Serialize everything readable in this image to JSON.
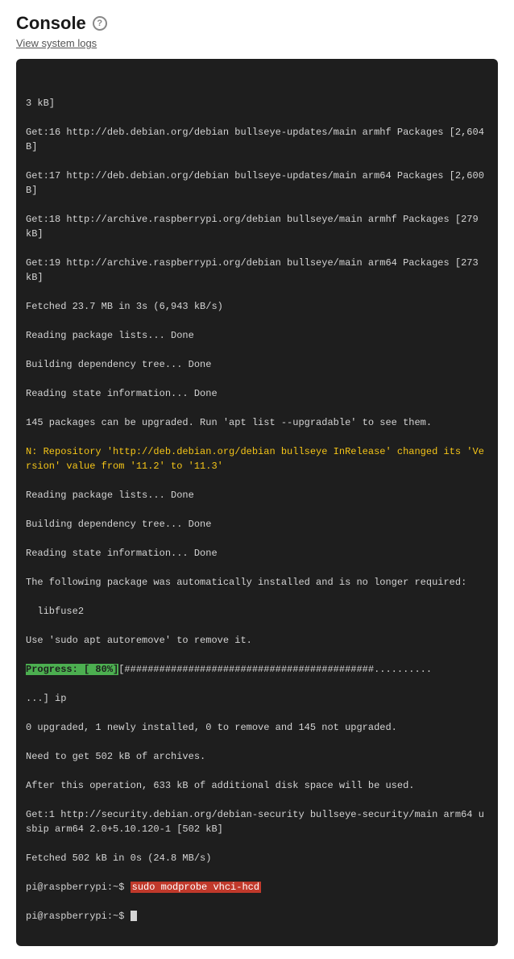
{
  "header": {
    "title": "Console",
    "help_tooltip": "Help",
    "subtitle": "View system logs"
  },
  "console": {
    "lines": [
      {
        "type": "normal",
        "text": "3 kB]"
      },
      {
        "type": "normal",
        "text": "Get:16 http://deb.debian.org/debian bullseye-updates/main armhf Packages [2,604 B]"
      },
      {
        "type": "normal",
        "text": "Get:17 http://deb.debian.org/debian bullseye-updates/main arm64 Packages [2,600 B]"
      },
      {
        "type": "normal",
        "text": "Get:18 http://archive.raspberrypi.org/debian bullseye/main armhf Packages [279 kB]"
      },
      {
        "type": "normal",
        "text": "Get:19 http://archive.raspberrypi.org/debian bullseye/main arm64 Packages [273 kB]"
      },
      {
        "type": "normal",
        "text": "Fetched 23.7 MB in 3s (6,943 kB/s)"
      },
      {
        "type": "normal",
        "text": "Reading package lists... Done"
      },
      {
        "type": "normal",
        "text": "Building dependency tree... Done"
      },
      {
        "type": "normal",
        "text": "Reading state information... Done"
      },
      {
        "type": "normal",
        "text": "145 packages can be upgraded. Run 'apt list --upgradable' to see them."
      },
      {
        "type": "yellow",
        "text": "N: Repository 'http://deb.debian.org/debian bullseye InRelease' changed its 'Version' value from '11.2' to '11.3'"
      },
      {
        "type": "normal",
        "text": "Reading package lists... Done"
      },
      {
        "type": "normal",
        "text": "Building dependency tree... Done"
      },
      {
        "type": "normal",
        "text": "Reading state information... Done"
      },
      {
        "type": "normal",
        "text": "The following package was automatically installed and is no longer required:"
      },
      {
        "type": "normal",
        "text": "  libfuse2"
      },
      {
        "type": "normal",
        "text": "Use 'sudo apt autoremove' to remove it."
      },
      {
        "type": "progress",
        "label": "Progress: [ 80%]",
        "bar": "[###########################################.........."
      },
      {
        "type": "normal",
        "text": "...] ip"
      },
      {
        "type": "normal",
        "text": "0 upgraded, 1 newly installed, 0 to remove and 145 not upgraded."
      },
      {
        "type": "normal",
        "text": "Need to get 502 kB of archives."
      },
      {
        "type": "normal",
        "text": "After this operation, 633 kB of additional disk space will be used."
      },
      {
        "type": "normal",
        "text": "Get:1 http://security.debian.org/debian-security bullseye-security/main arm64 usbip arm64 2.0+5.10.120-1 [502 kB]"
      },
      {
        "type": "normal",
        "text": "Fetched 502 kB in 0s (24.8 MB/s)"
      },
      {
        "type": "cmd",
        "prompt": "pi@raspberrypi:~$ ",
        "cmd": "sudo modprobe vhci-hcd"
      },
      {
        "type": "prompt_only",
        "prompt": "pi@raspberrypi:~$ "
      }
    ]
  }
}
